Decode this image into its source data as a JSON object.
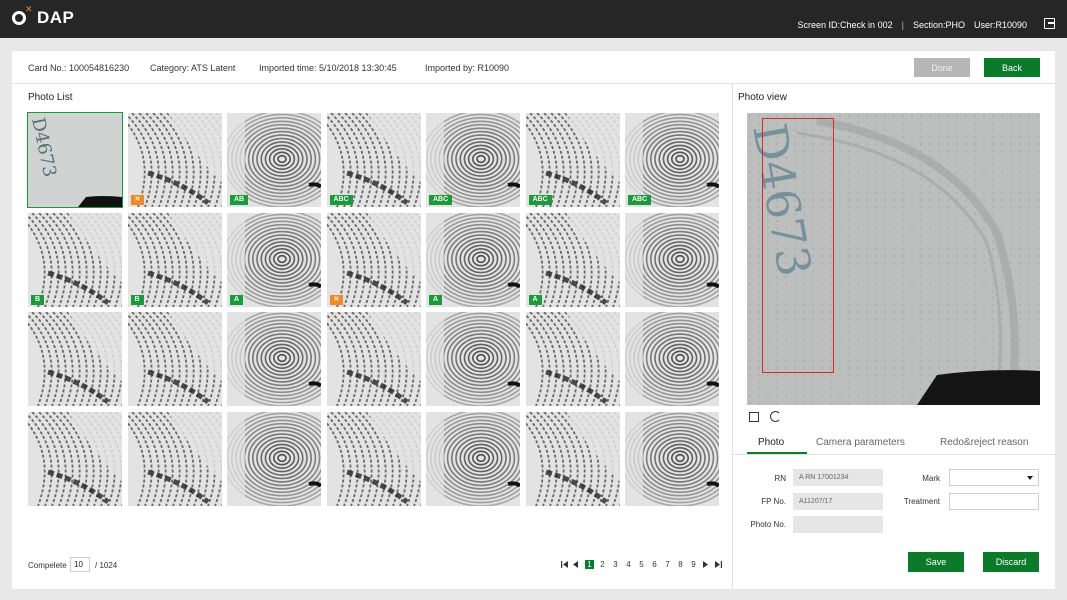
{
  "app": {
    "title": "DAP"
  },
  "header": {
    "screen_id": "Screen ID:Check in 002",
    "separator": "|",
    "section": "Section:PHO",
    "user": "User:R10090"
  },
  "info": {
    "card_no": "Card No.: 100054816230",
    "category": "Category: ATS Latent",
    "imported_time": "Imported time: 5/10/2018 13:30:45",
    "imported_by": "Imported by: R10090",
    "done_label": "Done",
    "back_label": "Back"
  },
  "photo_list": {
    "title": "Photo List",
    "thumbs": [
      {
        "kind": "card",
        "tag": "",
        "tag_color": "",
        "selected": true
      },
      {
        "kind": "partial",
        "tag": "✕",
        "tag_color": "orange",
        "selected": false
      },
      {
        "kind": "whorl",
        "tag": "AB",
        "tag_color": "green",
        "selected": false
      },
      {
        "kind": "partial",
        "tag": "ABC",
        "tag_color": "green",
        "selected": false
      },
      {
        "kind": "whorl",
        "tag": "ABC",
        "tag_color": "green",
        "selected": false
      },
      {
        "kind": "partial",
        "tag": "ABC",
        "tag_color": "green",
        "selected": false
      },
      {
        "kind": "whorl",
        "tag": "ABC",
        "tag_color": "green",
        "selected": false
      },
      {
        "kind": "partial",
        "tag": "B",
        "tag_color": "green",
        "selected": false
      },
      {
        "kind": "partial",
        "tag": "B",
        "tag_color": "green",
        "selected": false
      },
      {
        "kind": "whorl",
        "tag": "A",
        "tag_color": "green",
        "selected": false
      },
      {
        "kind": "partial",
        "tag": "✕",
        "tag_color": "orange",
        "selected": false
      },
      {
        "kind": "whorl",
        "tag": "A",
        "tag_color": "green",
        "selected": false
      },
      {
        "kind": "partial",
        "tag": "A",
        "tag_color": "green",
        "selected": false
      },
      {
        "kind": "whorl",
        "tag": "",
        "tag_color": "",
        "selected": false
      },
      {
        "kind": "partial",
        "tag": "",
        "tag_color": "",
        "selected": false
      },
      {
        "kind": "partial",
        "tag": "",
        "tag_color": "",
        "selected": false
      },
      {
        "kind": "whorl",
        "tag": "",
        "tag_color": "",
        "selected": false
      },
      {
        "kind": "partial",
        "tag": "",
        "tag_color": "",
        "selected": false
      },
      {
        "kind": "whorl",
        "tag": "",
        "tag_color": "",
        "selected": false
      },
      {
        "kind": "partial",
        "tag": "",
        "tag_color": "",
        "selected": false
      },
      {
        "kind": "whorl",
        "tag": "",
        "tag_color": "",
        "selected": false
      },
      {
        "kind": "partial",
        "tag": "",
        "tag_color": "",
        "selected": false
      },
      {
        "kind": "partial",
        "tag": "",
        "tag_color": "",
        "selected": false
      },
      {
        "kind": "whorl",
        "tag": "",
        "tag_color": "",
        "selected": false
      },
      {
        "kind": "partial",
        "tag": "",
        "tag_color": "",
        "selected": false
      },
      {
        "kind": "whorl",
        "tag": "",
        "tag_color": "",
        "selected": false
      },
      {
        "kind": "partial",
        "tag": "",
        "tag_color": "",
        "selected": false
      },
      {
        "kind": "whorl",
        "tag": "",
        "tag_color": "",
        "selected": false
      }
    ],
    "complete_label": "Compelete",
    "complete_value": "10",
    "complete_total": "/ 1024",
    "pager": {
      "pages": [
        "1",
        "2",
        "3",
        "4",
        "5",
        "6",
        "7",
        "8",
        "9"
      ],
      "active": "1"
    }
  },
  "photo_view": {
    "title": "Photo view",
    "tabs": [
      "Photo",
      "Camera parameters",
      "Redo&reject reason"
    ],
    "active_tab": "Photo",
    "form": {
      "rn_label": "RN",
      "rn_value": "A RN 17001234",
      "fp_label": "FP No.",
      "fp_value": "A11207/17",
      "photo_no_label": "Photo No.",
      "photo_no_value": "",
      "mark_label": "Mark",
      "mark_value": "",
      "treatment_label": "Treatment",
      "treatment_value": ""
    },
    "save_label": "Save",
    "discard_label": "Discard"
  },
  "colors": {
    "accent": "#0b7a2b",
    "tag_green": "#1a9a3a",
    "tag_orange": "#f08a24",
    "roi": "#d9262b",
    "topbar": "#262626"
  }
}
